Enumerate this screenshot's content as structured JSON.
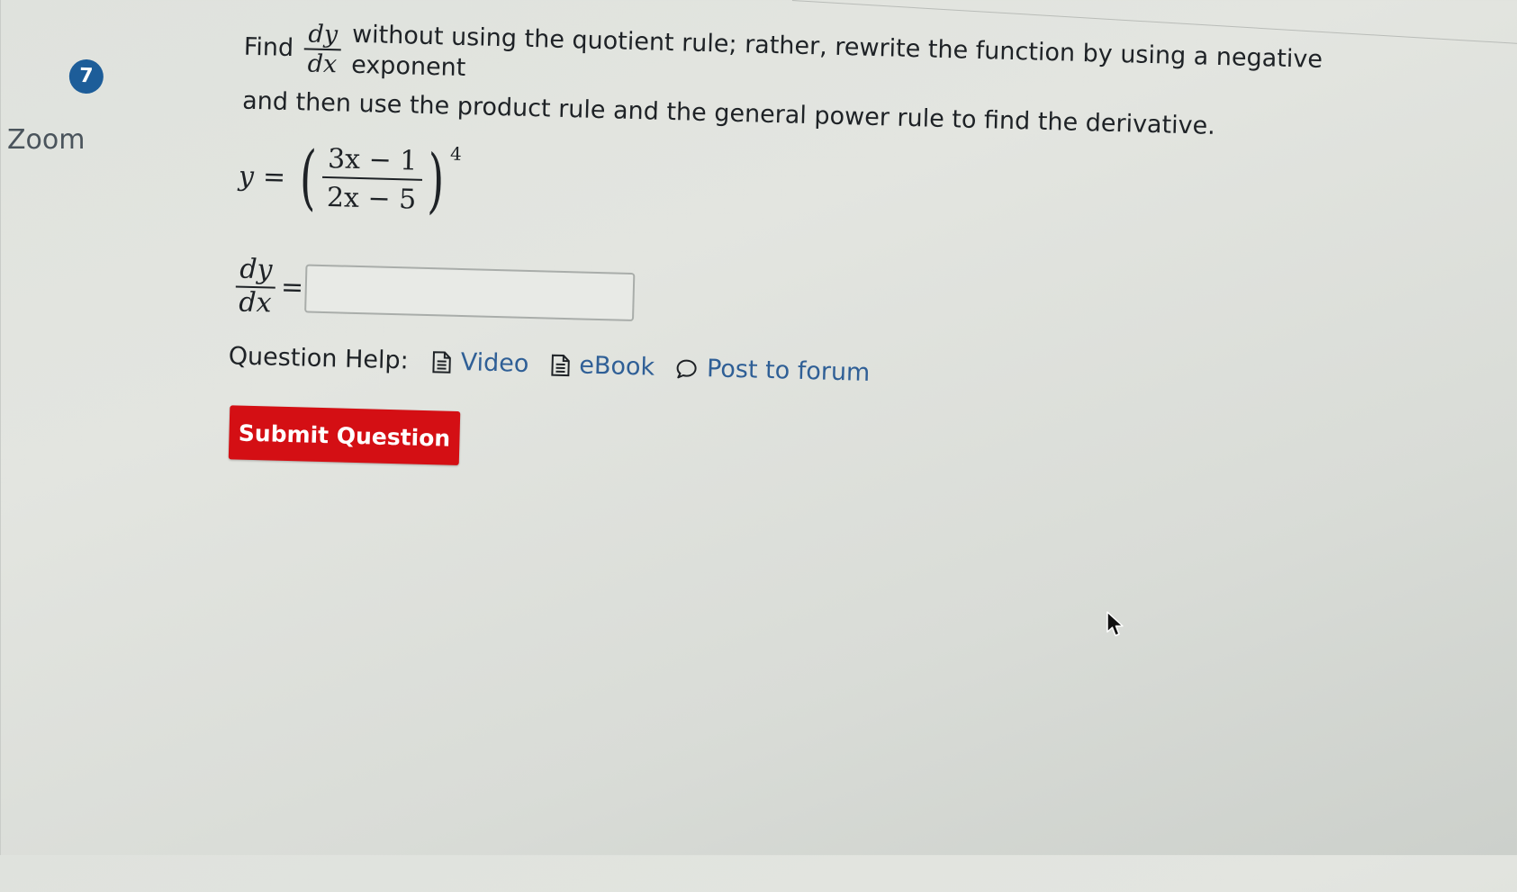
{
  "sidebar": {
    "zoom_label": "Zoom"
  },
  "question": {
    "number": "7",
    "prompt_find": "Find",
    "prompt_frac_num": "dy",
    "prompt_frac_den": "dx",
    "prompt_rest": "without using the quotient rule; rather, rewrite the function by using a negative exponent",
    "prompt_line2": "and then use the product rule and the general power rule to find the derivative.",
    "equation": {
      "lhs": "y",
      "equals": "=",
      "numerator": "3x − 1",
      "denominator": "2x − 5",
      "exponent": "4"
    },
    "answer": {
      "frac_num": "dy",
      "frac_den": "dx",
      "equals": "=",
      "value": "",
      "placeholder": ""
    }
  },
  "help": {
    "label": "Question Help:",
    "links": [
      {
        "label": "Video",
        "icon": "document-icon"
      },
      {
        "label": "eBook",
        "icon": "document-icon"
      },
      {
        "label": "Post to forum",
        "icon": "speech-bubble-icon"
      }
    ]
  },
  "submit": {
    "label": "Submit Question"
  },
  "colors": {
    "badge": "#1d5d99",
    "link": "#2f5f96",
    "submit": "#d40f14"
  }
}
